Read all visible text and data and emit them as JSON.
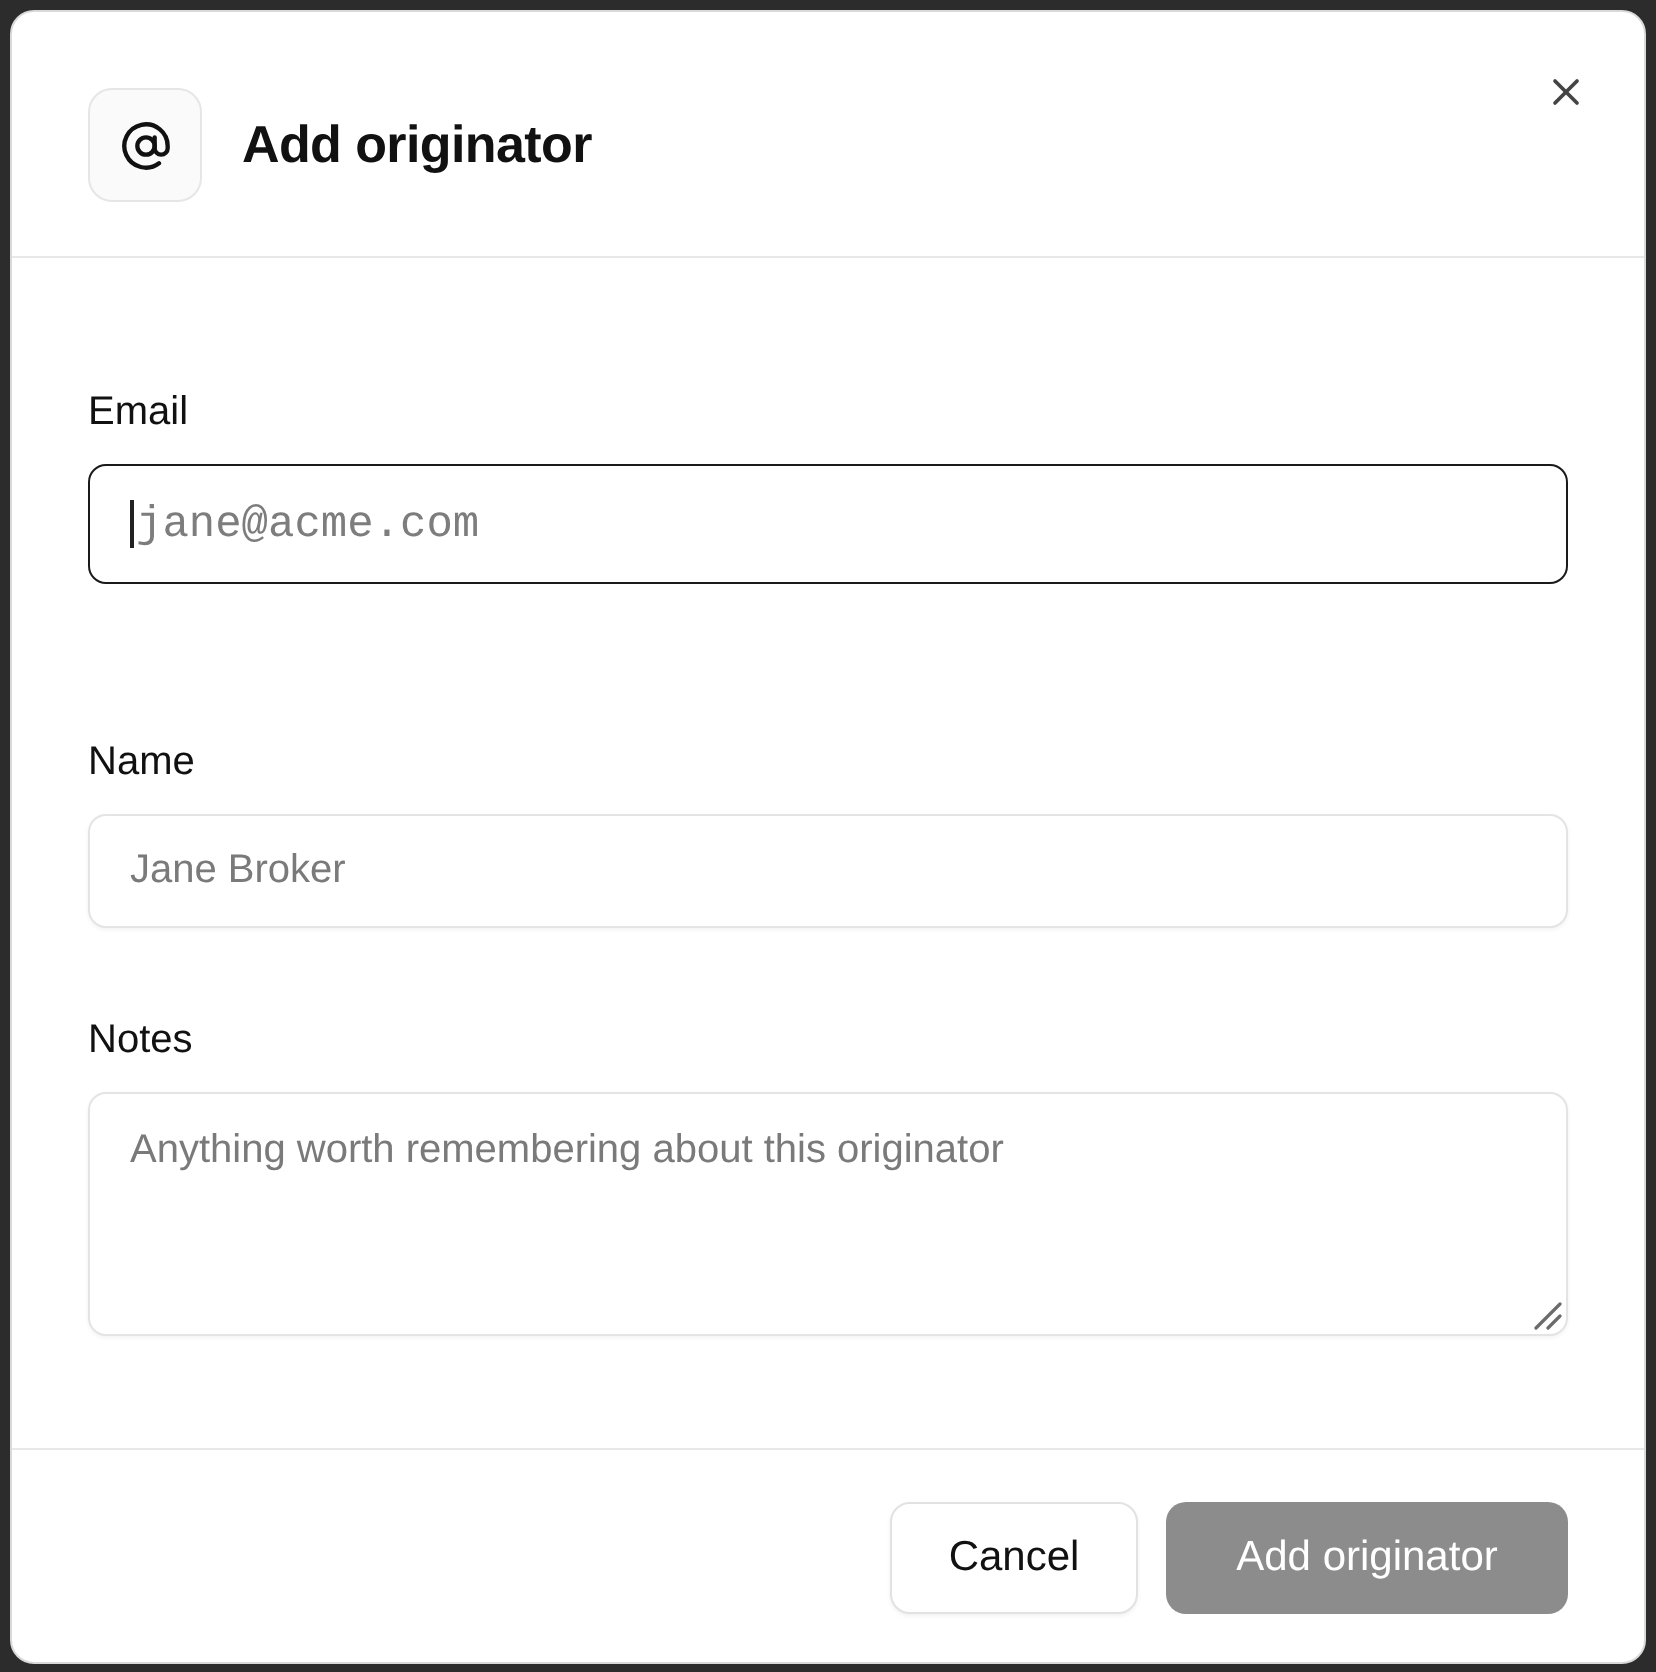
{
  "dialog": {
    "title": "Add originator",
    "fields": [
      {
        "kind": "email",
        "label": "Email",
        "placeholder": "jane@acme.com",
        "focused": true
      },
      {
        "kind": "text",
        "label": "Name",
        "placeholder": "Jane Broker",
        "focused": false
      },
      {
        "kind": "textarea",
        "label": "Notes",
        "placeholder": "Anything worth remembering about this originator",
        "focused": false
      }
    ],
    "buttons": [
      {
        "kind": "secondary",
        "label": "Cancel",
        "disabled": false
      },
      {
        "kind": "primary",
        "label": "Add originator",
        "disabled": true
      }
    ]
  }
}
